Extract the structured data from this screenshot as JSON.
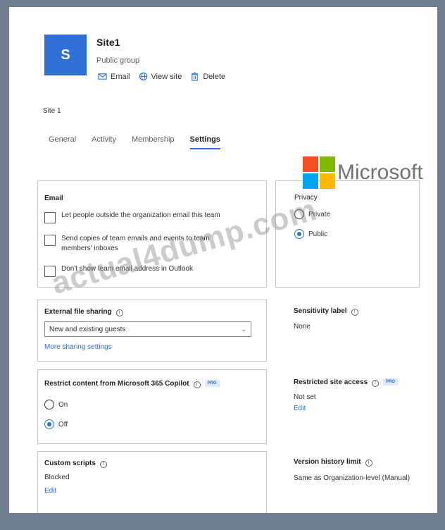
{
  "header": {
    "tile_letter": "S",
    "title": "Site1",
    "subtitle": "Public group",
    "actions": [
      {
        "icon": "mail-icon",
        "label": "Email"
      },
      {
        "icon": "globe-icon",
        "label": "View site"
      },
      {
        "icon": "trash-icon",
        "label": "Delete"
      }
    ]
  },
  "breadcrumb": "Site 1",
  "tabs": [
    {
      "label": "General",
      "active": false
    },
    {
      "label": "Activity",
      "active": false
    },
    {
      "label": "Membership",
      "active": false
    },
    {
      "label": "Settings",
      "active": true
    }
  ],
  "email": {
    "title": "Email",
    "options": [
      {
        "label": "Let people outside the organization email this team",
        "checked": false
      },
      {
        "label": "Send copies of team emails and events to team members' inboxes",
        "checked": false
      },
      {
        "label": "Don't show team email address in Outlook",
        "checked": false
      }
    ]
  },
  "privacy": {
    "title": "Privacy",
    "options": [
      {
        "label": "Private",
        "selected": false
      },
      {
        "label": "Public",
        "selected": true
      }
    ]
  },
  "external_sharing": {
    "title": "External file sharing",
    "selected": "New and existing guests",
    "more_link": "More sharing settings"
  },
  "sensitivity": {
    "title": "Sensitivity label",
    "value": "None"
  },
  "copilot": {
    "title": "Restrict content from Microsoft 365 Copilot",
    "badge": "PRO",
    "options": [
      {
        "label": "On",
        "selected": false
      },
      {
        "label": "Off",
        "selected": true
      }
    ]
  },
  "restricted_access": {
    "title": "Restricted site access",
    "badge": "PRO",
    "value": "Not set",
    "edit": "Edit"
  },
  "custom_scripts": {
    "title": "Custom scripts",
    "value": "Blocked",
    "edit": "Edit"
  },
  "version_history": {
    "title": "Version history limit",
    "value": "Same as Organization-level (Manual)"
  },
  "overlay": {
    "watermark": "actual4dump.com",
    "ms_logo_text": "Microsoft",
    "ms_colors": [
      "#f25022",
      "#7fba00",
      "#00a4ef",
      "#ffb900"
    ]
  },
  "colors": {
    "accent": "#2f6fd6",
    "tile": "#2f6fd6",
    "background": "#6f7f8f"
  }
}
